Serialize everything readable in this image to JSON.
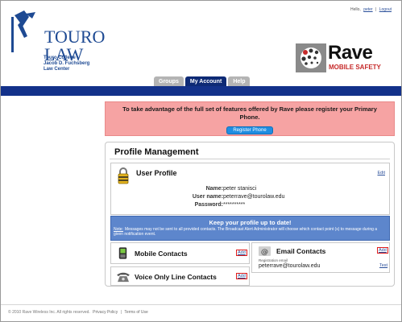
{
  "top_links": {
    "hello": "Hello,",
    "user": "peter",
    "separator": "|",
    "logout": "Logout"
  },
  "branding": {
    "touro_word_1": "TOURO",
    "touro_word_2": "LAW",
    "touro_sub_1": "Touro College",
    "touro_sub_2": "Jacob D. Fuchsberg",
    "touro_sub_3": "Law Center",
    "rave_word": "Rave",
    "rave_sub": "MOBILE SAFETY",
    "colors": {
      "touro_blue": "#1e4a93",
      "rave_red": "#c62a2a",
      "nav_blue": "#13318a"
    }
  },
  "tabs": [
    {
      "label": "Groups",
      "active": false
    },
    {
      "label": "My Account",
      "active": true
    },
    {
      "label": "Help",
      "active": false
    }
  ],
  "register_banner": {
    "text": "To take advantage of the full set of features offered by Rave please register your Primary Phone.",
    "button": "Register Phone"
  },
  "profile_management": {
    "title": "Profile Management",
    "user_profile": {
      "title": "User Profile",
      "edit": "Edit",
      "fields": [
        {
          "label": "Name:",
          "value": "peter stanisci"
        },
        {
          "label": "User name:",
          "value": "peterrave@tourolaw.edu"
        },
        {
          "label": "Password:",
          "value": "**********"
        }
      ]
    },
    "keep_up_to_date": {
      "title": "Keep your profile up to date!",
      "note_label": "Note:",
      "note_text": "Messages may not be sent to all provided contacts. The Broadcast Alert Administrator will choose which contact point (s) to message during a given notification event."
    },
    "mobile_contacts": {
      "title": "Mobile Contacts",
      "add": "Add"
    },
    "voice_contacts": {
      "title": "Voice Only Line Contacts",
      "add": "Add"
    },
    "email_contacts": {
      "title": "Email Contacts",
      "add": "Add",
      "reg_label": "Registration email",
      "email": "peterrave@tourolaw.edu",
      "test": "Test"
    }
  },
  "footer": {
    "copyright": "© 2010 Rave Wireless Inc. All rights reserved.",
    "privacy": "Privacy Policy",
    "separator": "|",
    "terms": "Terms of Use"
  }
}
